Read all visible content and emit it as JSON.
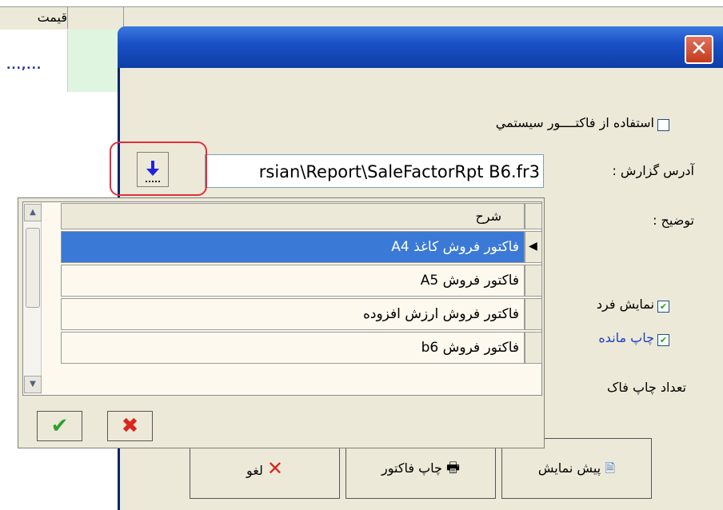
{
  "background_grid": {
    "price_header": "قیمت",
    "cell_value": "...,..."
  },
  "dialog": {
    "close_label": "✕",
    "use_system_invoice_label": "استفاده از فاکتــــور سیستمي",
    "use_system_invoice_checked": false,
    "report_address_label": "آدرس گزارش :",
    "report_path_value": "rsian\\Report\\SaleFactorRpt B6.fr3",
    "description_label": "توضیح :",
    "show_label": "نمایش فرد",
    "print_remaining_label": "چاپ مانده",
    "invoice_count_label": "تعداد چاپ فاک",
    "buttons": {
      "cancel": "لغو",
      "print_invoice": "چاپ فاکتور",
      "preview": "پیش نمایش"
    }
  },
  "lookup": {
    "column_header": "شرح",
    "rows": [
      "فاکتور فروش کاغذ A4",
      "فاکتور فروش A5",
      "فاکتور فروش ارزش افزوده",
      "فاکتور فروش b6"
    ],
    "selected_index": 0
  },
  "colors": {
    "titlebar": "#1b52c7",
    "selection": "#3b79d6",
    "highlight": "#e0303a"
  }
}
